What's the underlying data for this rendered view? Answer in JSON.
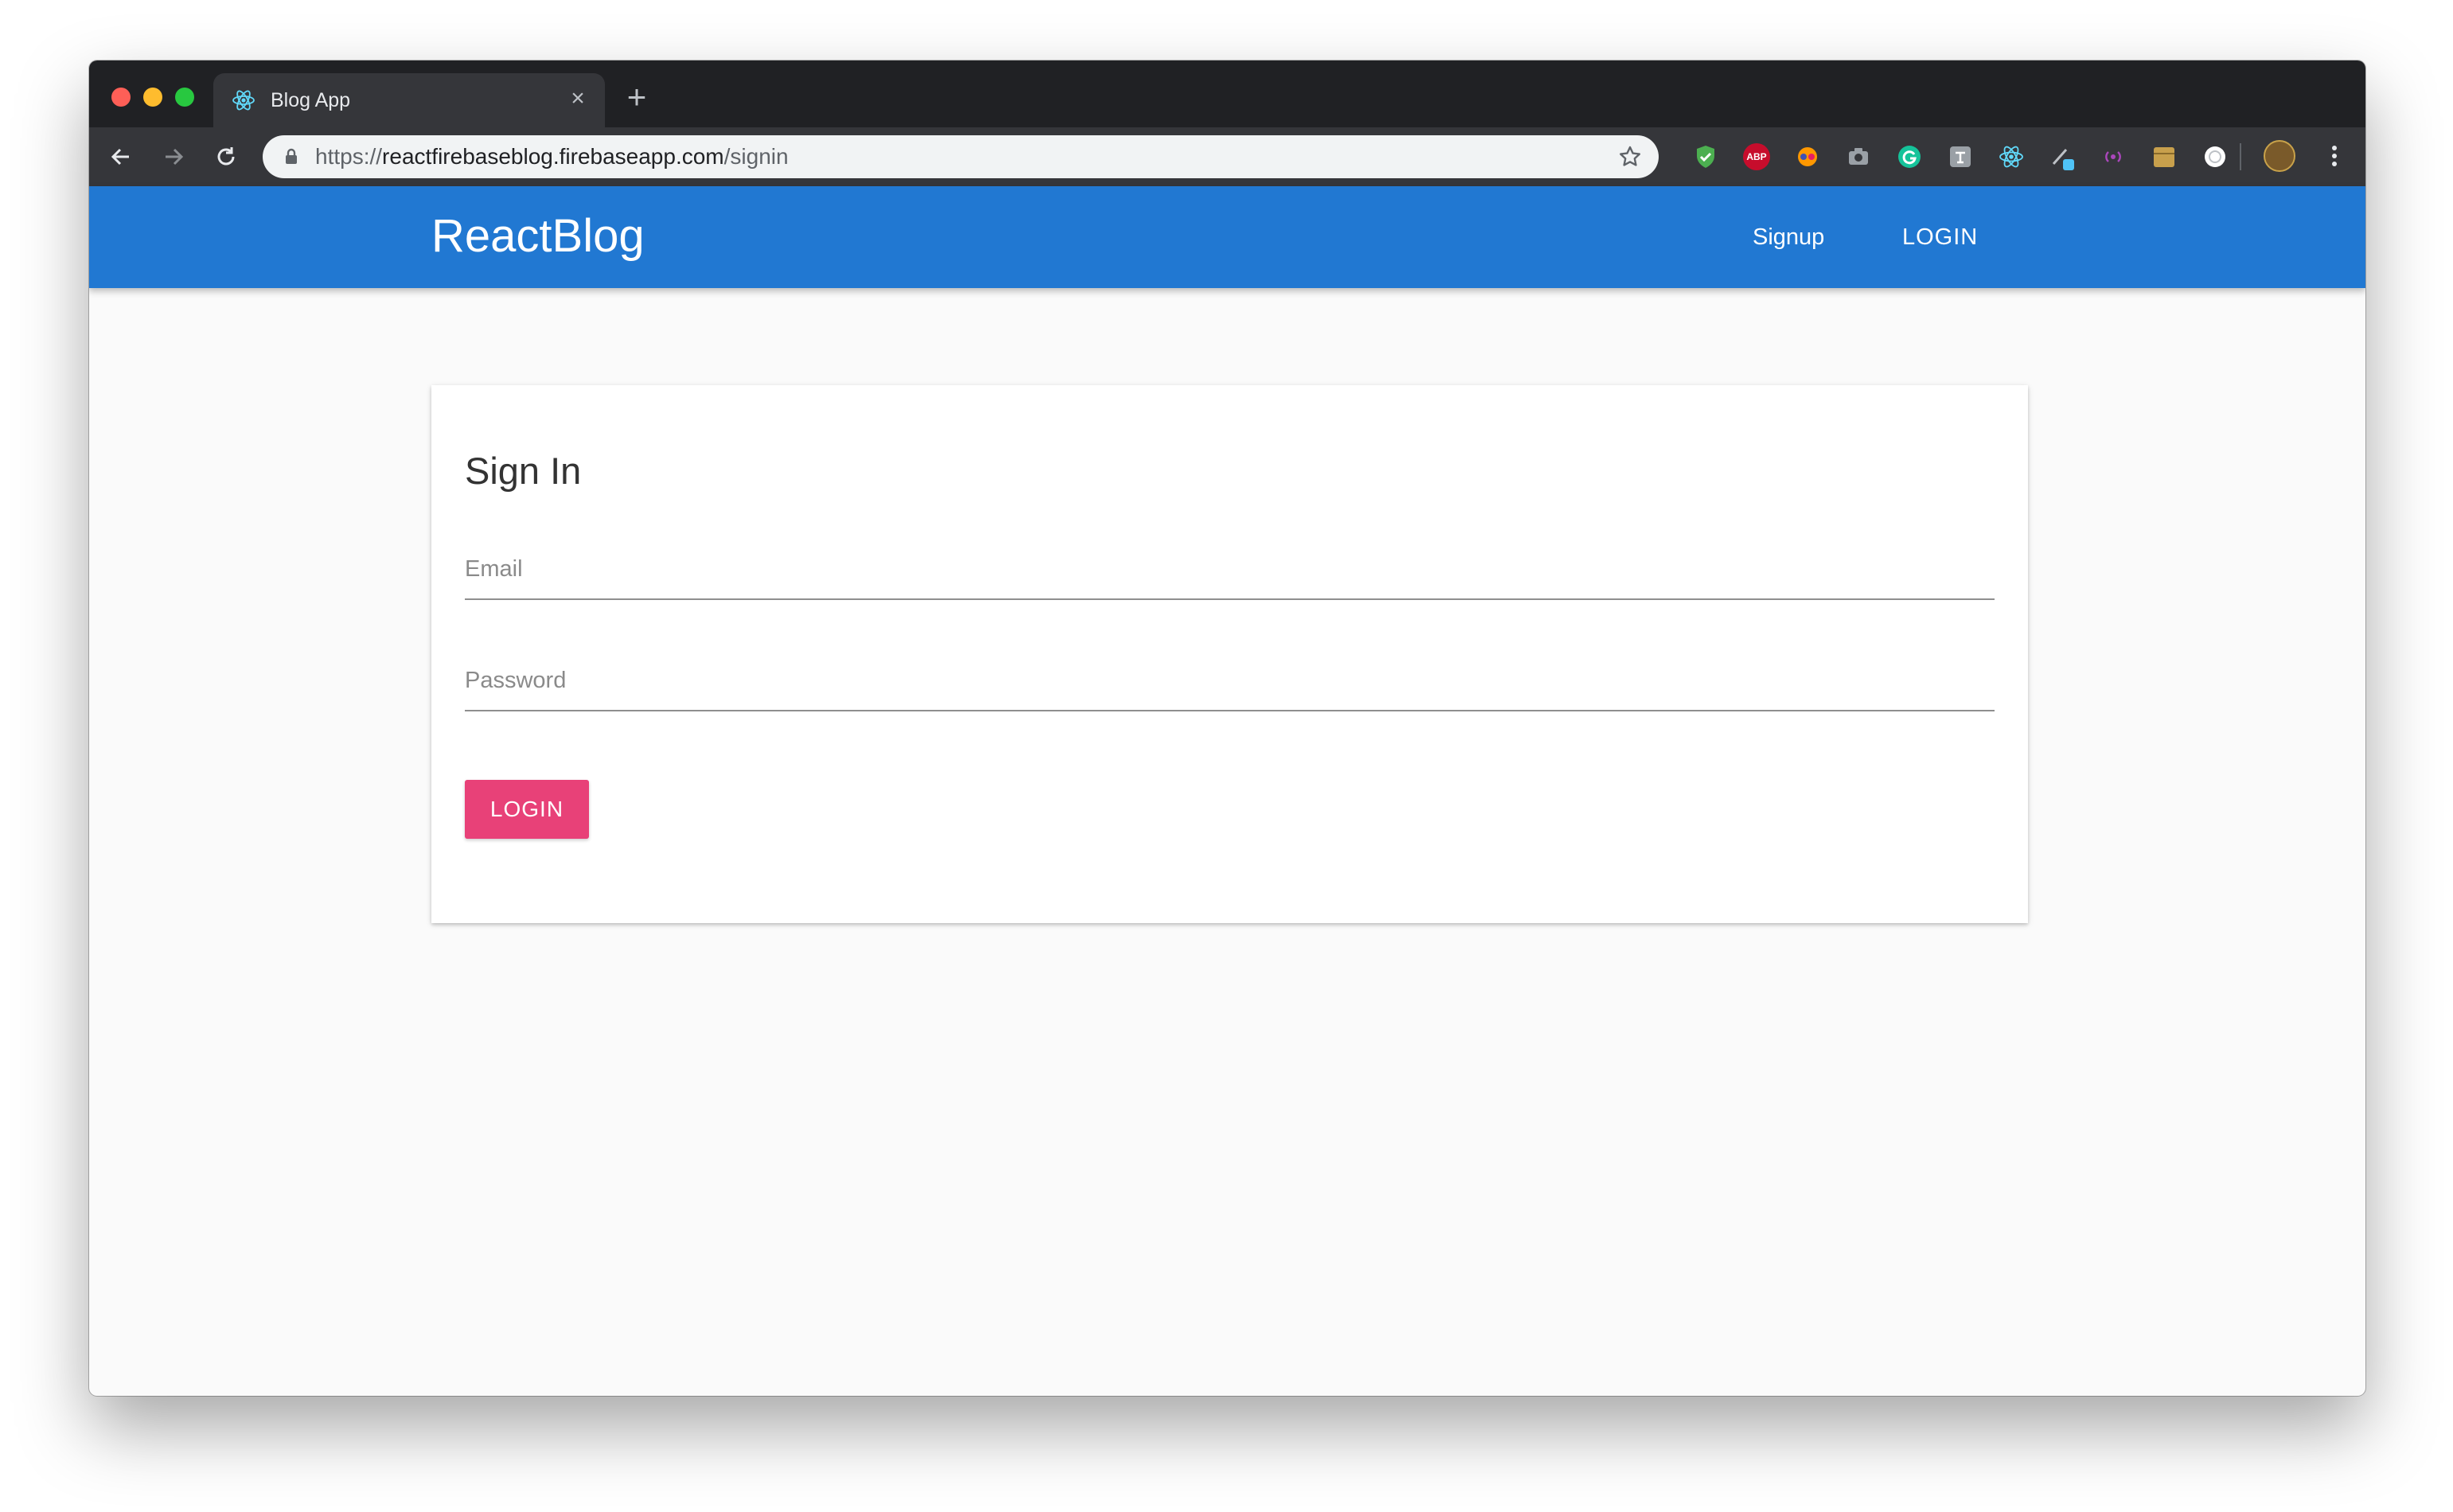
{
  "browser": {
    "tab_title": "Blog App",
    "tab_close": "×",
    "new_tab": "+",
    "url_scheme": "https://",
    "url_host": "reactfirebaseblog.firebaseapp.com",
    "url_path": "/signin",
    "extensions": [
      {
        "name": "shield-check-extension-icon",
        "color": "#4caf50"
      },
      {
        "name": "adblock-plus-icon",
        "label": "ABP",
        "color": "#c70d2c"
      },
      {
        "name": "rainbow-eyes-extension-icon",
        "color": "#ff9800"
      },
      {
        "name": "camera-extension-icon",
        "color": "#9aa0a6"
      },
      {
        "name": "grammarly-icon",
        "color": "#15c39a"
      },
      {
        "name": "translate-extension-icon",
        "color": "#9aa0a6"
      },
      {
        "name": "react-devtools-icon",
        "color": "#61dafb"
      },
      {
        "name": "pen-tool-extension-icon",
        "color": "#4fc3f7"
      },
      {
        "name": "wireless-extension-icon",
        "color": "#ab47bc"
      },
      {
        "name": "box-extension-icon",
        "color": "#c8a04c"
      },
      {
        "name": "circle-extension-icon",
        "color": "#ffffff"
      }
    ]
  },
  "header": {
    "brand": "ReactBlog",
    "nav": {
      "signup": "Signup",
      "login": "LOGIN"
    },
    "color": "#2178d2"
  },
  "signin": {
    "title": "Sign In",
    "email_placeholder": "Email",
    "email_value": "",
    "password_placeholder": "Password",
    "password_value": "",
    "submit_label": "LOGIN",
    "accent": "#e84178"
  }
}
